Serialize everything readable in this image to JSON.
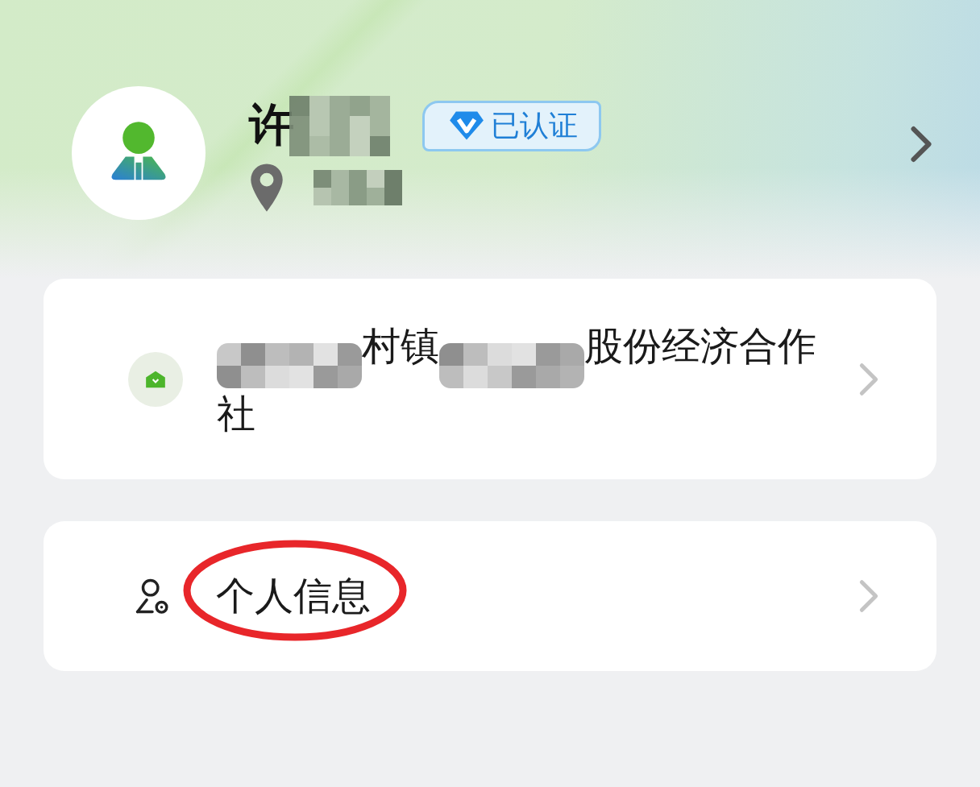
{
  "profile": {
    "name": "许",
    "name_obscured": true,
    "verified_badge": "已认证",
    "location_obscured": true
  },
  "organization": {
    "name_parts": [
      {
        "kind": "obscured"
      },
      {
        "kind": "text",
        "text": "村镇"
      },
      {
        "kind": "obscured"
      },
      {
        "kind": "text",
        "text": "股份经济合作社"
      }
    ]
  },
  "menu_items": [
    {
      "label": "个人信息",
      "highlighted": true
    }
  ]
}
